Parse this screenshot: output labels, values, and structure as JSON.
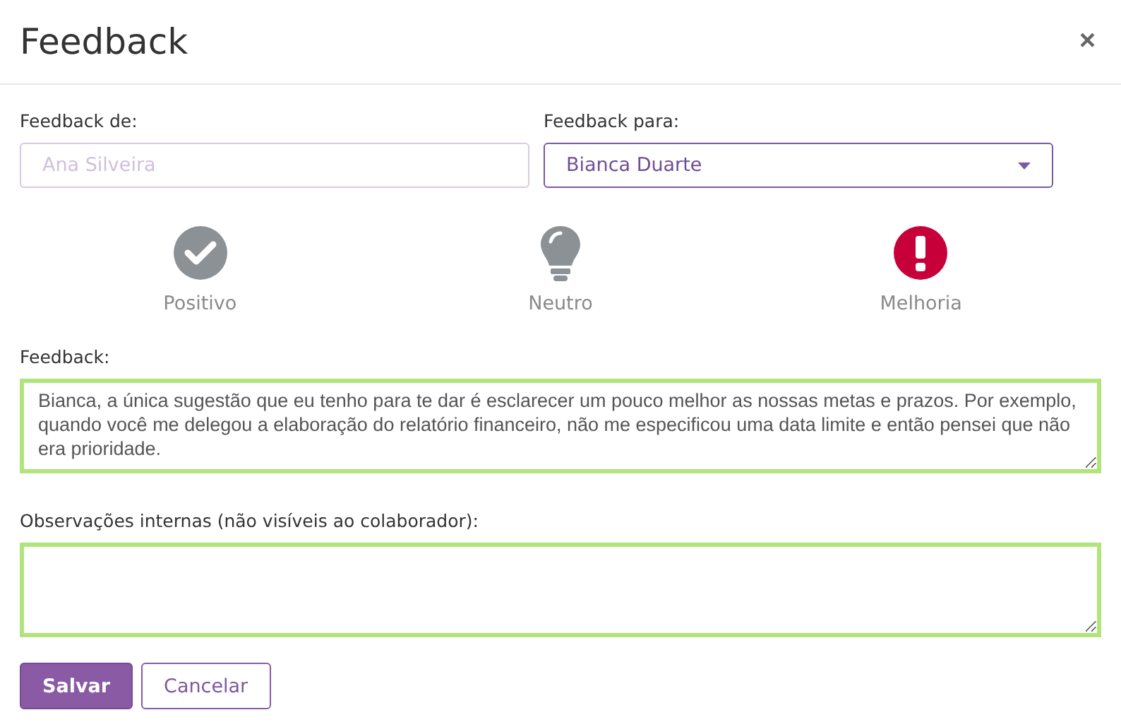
{
  "dialog": {
    "title": "Feedback",
    "close": "×"
  },
  "from": {
    "label": "Feedback de:",
    "placeholder": "Ana Silveira"
  },
  "to": {
    "label": "Feedback para:",
    "value": "Bianca Duarte"
  },
  "types": [
    {
      "kind": "positive",
      "label": "Positivo",
      "selected": false
    },
    {
      "kind": "neutral",
      "label": "Neutro",
      "selected": false
    },
    {
      "kind": "improvement",
      "label": "Melhoria",
      "selected": true
    }
  ],
  "feedback": {
    "label": "Feedback:",
    "value": "Bianca, a única sugestão que eu tenho para te dar é esclarecer um pouco melhor as nossas metas e prazos. Por exemplo, quando você me delegou a elaboração do relatório financeiro, não me especificou uma data limite e então pensei que não era prioridade."
  },
  "notes": {
    "label": "Observações internas (não visíveis ao colaborador):"
  },
  "buttons": [
    {
      "kind": "primary",
      "label": "Salvar"
    },
    {
      "kind": "secondary",
      "label": "Cancelar"
    }
  ]
}
